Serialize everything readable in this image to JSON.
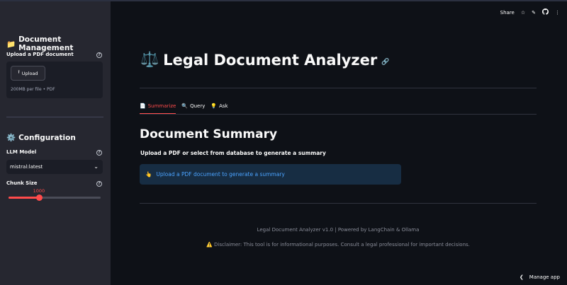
{
  "sidebar": {
    "doc_header_icon": "folder-icon",
    "doc_header": "Document Management",
    "upload_label": "Upload a PDF document",
    "upload_button": "Upload",
    "upload_hint": "200MB per file • PDF",
    "config_header_icon": "gear-icon",
    "config_header": "Configuration",
    "llm_label": "LLM Model",
    "llm_value": "mistral:latest",
    "chunk_label": "Chunk Size",
    "chunk_value": "1000",
    "chunk_fraction": 0.33
  },
  "toolbar": {
    "share": "Share"
  },
  "main": {
    "title_icon": "⚖️",
    "title": "Legal Document Analyzer",
    "tabs": [
      {
        "icon": "📄",
        "label": "Summarize"
      },
      {
        "icon": "🔍",
        "label": "Query"
      },
      {
        "icon": "💡",
        "label": "Ask"
      }
    ],
    "section_title": "Document Summary",
    "section_sub": "Upload a PDF or select from database to generate a summary",
    "info_icon": "👆",
    "info_text": "Upload a PDF document to generate a summary",
    "footer_line1": "Legal Document Analyzer v1.0 | Powered by LangChain & Ollama",
    "footer_icon": "⚠️",
    "footer_line2": "Disclaimer: This tool is for informational purposes. Consult a legal professional for important decisions."
  },
  "manage_app": "Manage app",
  "colors": {
    "accent": "#ff4b4b",
    "info_bg": "#172d43",
    "info_text": "#4ba3ff"
  }
}
